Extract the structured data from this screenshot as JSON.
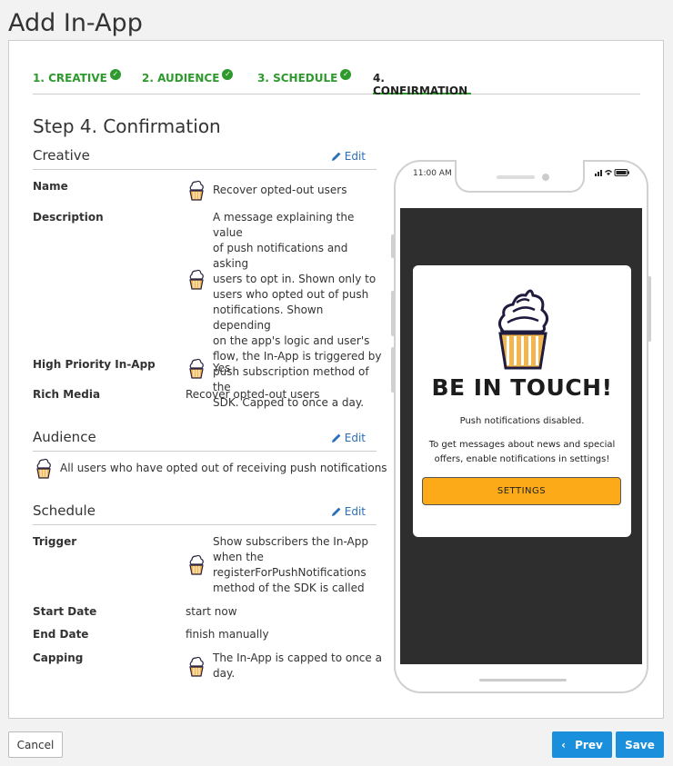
{
  "page": {
    "title": "Add In-App"
  },
  "steps": [
    {
      "label": "1. CREATIVE",
      "done": true
    },
    {
      "label": "2. AUDIENCE",
      "done": true
    },
    {
      "label": "3. SCHEDULE",
      "done": true
    },
    {
      "label": "4. CONFIRMATION",
      "done": false,
      "active": true
    }
  ],
  "step_heading": "Step 4. Confirmation",
  "creative": {
    "title": "Creative",
    "edit_label": "Edit",
    "name_label": "Name",
    "name_value": "Recover opted-out users",
    "description_label": "Description",
    "description_lines": [
      "A message explaining the value",
      "of push notifications and asking",
      "users to opt in. Shown only to",
      "users who opted out of push",
      "notifications. Shown depending",
      "on the app's logic and user's",
      "flow, the In-App is triggered by",
      "push subscription method of the",
      "SDK. Capped to once a day."
    ],
    "priority_label": "High Priority In-App",
    "priority_value": "Yes",
    "rich_media_label": "Rich Media",
    "rich_media_value": "Recover opted-out users"
  },
  "audience": {
    "title": "Audience",
    "edit_label": "Edit",
    "value": "All users who have opted out of receiving push notifications"
  },
  "schedule": {
    "title": "Schedule",
    "edit_label": "Edit",
    "trigger_label": "Trigger",
    "trigger_lines": [
      "Show subscribers the In-App",
      "when the",
      "registerForPushNotifications",
      "method of the SDK is called"
    ],
    "start_label": "Start Date",
    "start_value": "start now",
    "end_label": "End Date",
    "end_value": "finish manually",
    "capping_label": "Capping",
    "capping_lines": [
      "The In-App is capped to once a",
      "day."
    ]
  },
  "preview": {
    "time": "11:00 AM",
    "title": "BE IN TOUCH!",
    "subtitle": "Push notifications disabled.",
    "body_lines": [
      "To get messages about news and special",
      "offers, enable notifications in settings!"
    ],
    "button": "SETTINGS"
  },
  "footer": {
    "cancel": "Cancel",
    "prev": "Prev",
    "save": "Save"
  },
  "colors": {
    "accent_green": "#2e9a2e",
    "primary_blue": "#1a8fdc",
    "link_blue": "#2a6fba",
    "popup_button": "#fcaa17"
  }
}
